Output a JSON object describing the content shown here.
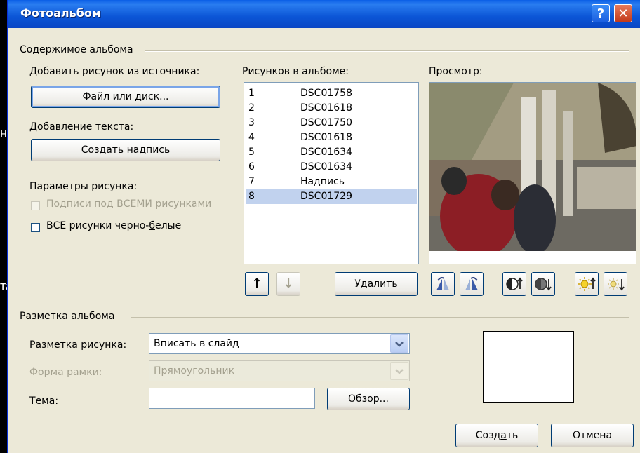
{
  "background": {
    "left_fragment_1": "ні",
    "left_fragment_2": "та"
  },
  "window": {
    "title": "Фотоальбом",
    "help_glyph": "?",
    "close_glyph": "✕"
  },
  "album_content": {
    "heading": "Содержимое альбома",
    "add_picture_label": "Добавить рисунок из источника:",
    "file_button": {
      "pre": "Файл или ",
      "u": "д",
      "post": "иск..."
    },
    "add_text_label": "Добавление текста:",
    "caption_button": {
      "pre": "Создать надпис",
      "u": "ь",
      "post": ""
    },
    "picture_options_label": "Параметры рисунка:",
    "captions_checkbox": {
      "label": "Подписи под ВСЕМИ рисунками",
      "checked": false,
      "enabled": false
    },
    "bw_checkbox": {
      "label_pre": "ВСЕ рисунки черно-",
      "label_u": "б",
      "label_post": "елые",
      "checked": false
    },
    "pictures_label": "Рисунков в альбоме:",
    "pictures": [
      {
        "n": "1",
        "name": "DSC01758"
      },
      {
        "n": "2",
        "name": "DSC01618"
      },
      {
        "n": "3",
        "name": "DSC01750"
      },
      {
        "n": "4",
        "name": "DSC01618"
      },
      {
        "n": "5",
        "name": "DSC01634"
      },
      {
        "n": "6",
        "name": "DSC01634"
      },
      {
        "n": "7",
        "name": "Надпись"
      },
      {
        "n": "8",
        "name": "DSC01729"
      }
    ],
    "selected_index": 7,
    "delete_button": {
      "pre": "Удал",
      "u": "и",
      "post": "ть"
    },
    "preview_label": "Просмотр:",
    "move_up_glyph": "↑",
    "move_down_glyph": "↓"
  },
  "album_layout": {
    "heading": "Разметка альбома",
    "picture_layout_label": {
      "pre": "Разметка ",
      "u": "р",
      "post": "исунка:"
    },
    "picture_layout_value": "Вписать в слайд",
    "frame_shape_label": "Форма рамки:",
    "frame_shape_value": "Прямоугольник",
    "theme_label": {
      "pre": "",
      "u": "Т",
      "post": "ема:"
    },
    "theme_value": "",
    "browse_button": {
      "pre": "Об",
      "u": "з",
      "post": "ор..."
    }
  },
  "footer": {
    "create_button": {
      "pre": "Созд",
      "u": "а",
      "post": "ть"
    },
    "cancel_button": "Отмена"
  },
  "colors": {
    "title_bar": "#0b55d6",
    "dialog_bg": "#ece9d8",
    "selection": "#c1d2ee"
  }
}
